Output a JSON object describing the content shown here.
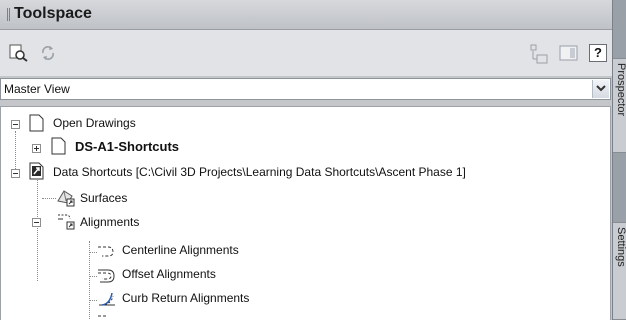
{
  "app": {
    "title": "Toolspace"
  },
  "view_select": {
    "value": "Master View"
  },
  "side_tabs": [
    "Prospector",
    "Settings"
  ],
  "tree": {
    "open_drawings": "Open Drawings",
    "current_drawing": "DS-A1-Shortcuts",
    "data_shortcuts": "Data Shortcuts [C:\\Civil 3D Projects\\Learning Data Shortcuts\\Ascent Phase 1]",
    "surfaces": "Surfaces",
    "alignments": "Alignments",
    "centerline": "Centerline Alignments",
    "offset": "Offset Alignments",
    "curb_return": "Curb Return Alignments"
  }
}
